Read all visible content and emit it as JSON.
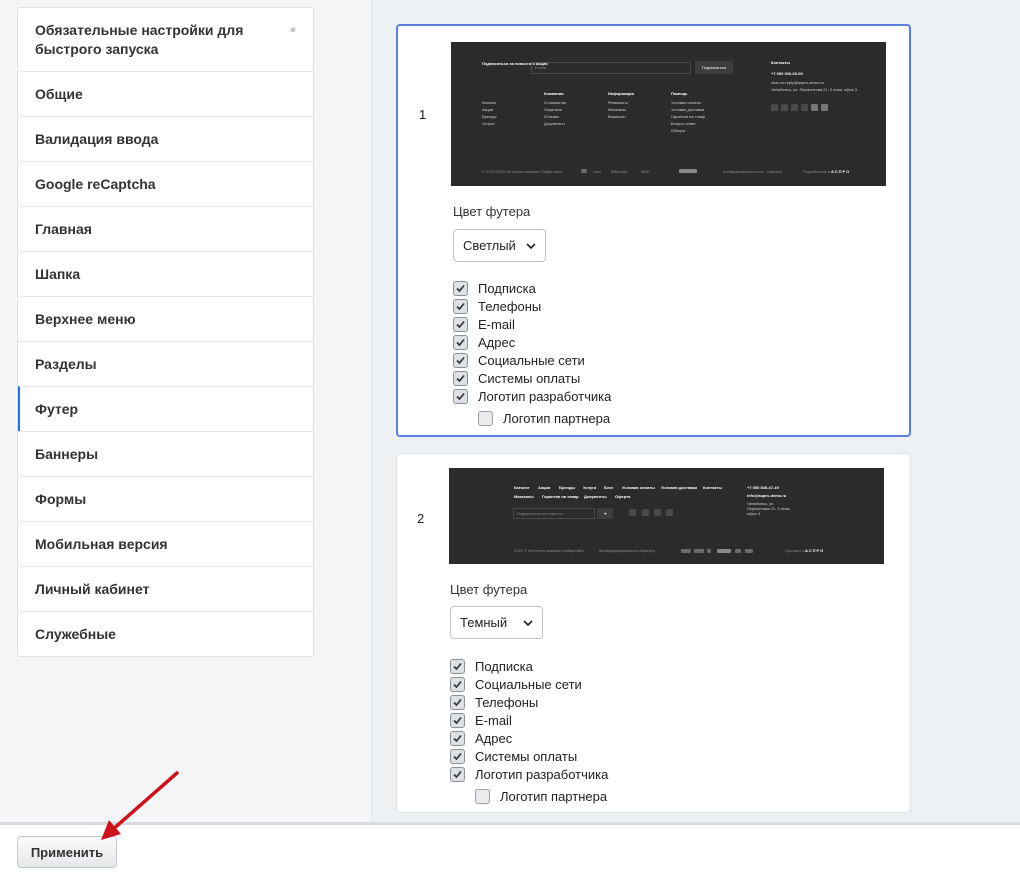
{
  "sidebar": {
    "items": [
      {
        "label": "Обязательные настройки для быстрого запуска"
      },
      {
        "label": "Общие"
      },
      {
        "label": "Валидация ввода"
      },
      {
        "label": "Google reCaptcha"
      },
      {
        "label": "Главная"
      },
      {
        "label": "Шапка"
      },
      {
        "label": "Верхнее меню"
      },
      {
        "label": "Разделы"
      },
      {
        "label": "Футер"
      },
      {
        "label": "Баннеры"
      },
      {
        "label": "Формы"
      },
      {
        "label": "Мобильная версия"
      },
      {
        "label": "Личный кабинет"
      },
      {
        "label": "Служебные"
      }
    ],
    "active_index": 8,
    "star": "*"
  },
  "cards": [
    {
      "number": "1",
      "color_label": "Цвет футера",
      "color_value": "Светлый",
      "checkboxes": [
        {
          "label": "Подписка",
          "checked": true
        },
        {
          "label": "Телефоны",
          "checked": true
        },
        {
          "label": "E-mail",
          "checked": true
        },
        {
          "label": "Адрес",
          "checked": true
        },
        {
          "label": "Социальные сети",
          "checked": true
        },
        {
          "label": "Системы оплаты",
          "checked": true
        },
        {
          "label": "Логотип разработчика",
          "checked": true
        }
      ],
      "partner_logo": {
        "label": "Логотип партнера",
        "checked": false
      }
    },
    {
      "number": "2",
      "color_label": "Цвет футера",
      "color_value": "Темный",
      "checkboxes": [
        {
          "label": "Подписка",
          "checked": true
        },
        {
          "label": "Социальные сети",
          "checked": true
        },
        {
          "label": "Телефоны",
          "checked": true
        },
        {
          "label": "E-mail",
          "checked": true
        },
        {
          "label": "Адрес",
          "checked": true
        },
        {
          "label": "Системы оплаты",
          "checked": true
        },
        {
          "label": "Логотип разработчика",
          "checked": true
        }
      ],
      "partner_logo": {
        "label": "Логотип партнера",
        "checked": false
      }
    }
  ],
  "preview1": {
    "subscribe_title": "Подписаться на новости и акции",
    "email_placeholder": "E-mail",
    "subscribe_button": "Подписаться",
    "contacts_title": "Контакты",
    "phone": "+7 000 000-00-00",
    "email": "shal.no-reply@aspro-demo.ru",
    "address": "Челябинск, ул. Лермонтова 21, 3 этаж, офис 3",
    "col_catalog": [
      "Каталог",
      "Акции",
      "Бренды",
      "Услуги"
    ],
    "col_company_title": "Компания",
    "col_company": [
      "О компании",
      "Лицензии",
      "Отзывы",
      "Документы"
    ],
    "col_info_title": "Информация",
    "col_info": [
      "Реквизиты",
      "Магазины",
      "Вакансии"
    ],
    "col_help_title": "Помощь",
    "col_help": [
      "Условия оплаты",
      "Условия доставки",
      "Гарантия на товар",
      "Вопрос-ответ",
      "Обзоры"
    ],
    "copyright": "© 2022-2025 Интернет-магазин Лайфстайл",
    "privacy": "Конфиденциальность",
    "offer": "Оферта",
    "dev": "Разработано в",
    "dev_logo": "АСПРО",
    "pay": [
      "Visa",
      "ЮMoney",
      "МИР",
      "Tinkoff"
    ]
  },
  "preview2": {
    "menu_row1": [
      "Каталог",
      "Акции",
      "Бренды",
      "Услуги",
      "Блог",
      "Условия оплаты",
      "Условия доставки",
      "Контакты"
    ],
    "menu_row2": [
      "Магазины",
      "Гарантия на товар",
      "Документы",
      "Оферта"
    ],
    "phone": "+7 000 545-47-49",
    "email": "info@aspro-demo.ru",
    "address": "Челябинск, ул. Лермонтова 21, 3 этаж, офис 4",
    "subscribe_placeholder": "Подписаться на новости",
    "copyright": "2022 © Интернет-магазин Лайфстайл",
    "privacy": "Конфиденциальность",
    "offer": "Оферта",
    "dev": "Сделано в",
    "dev_logo": "АСПРО"
  },
  "apply_button": "Применить",
  "colors": {
    "accent": "#5b7fe0",
    "active_marker": "#2f6fdb",
    "annotation_arrow": "#c9141c"
  }
}
